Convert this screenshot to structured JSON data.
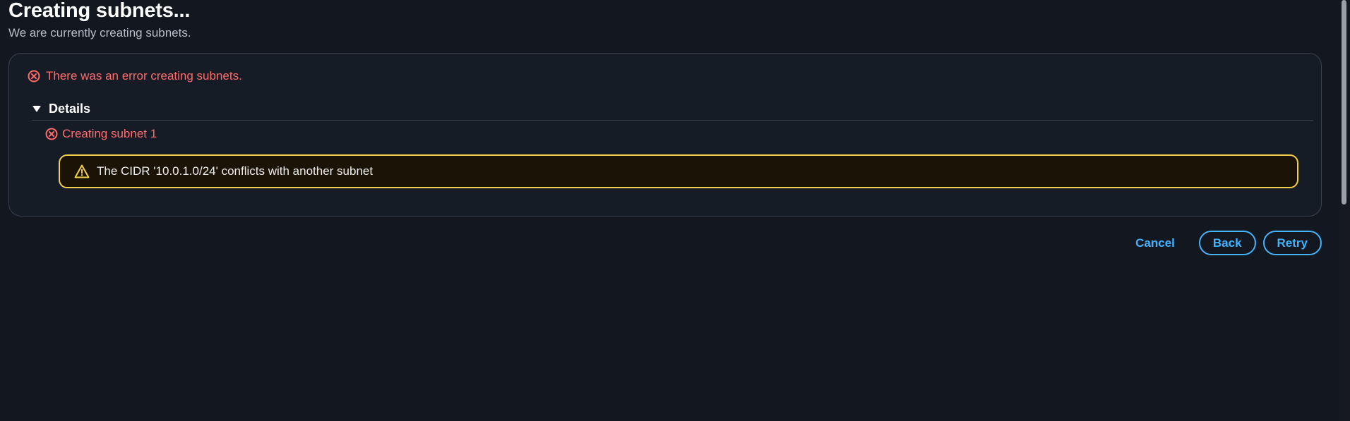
{
  "header": {
    "title": "Creating subnets...",
    "subtitle": "We are currently creating subnets."
  },
  "status": {
    "error_message": "There was an error creating subnets.",
    "error_icon": "error-circle-x-icon",
    "error_color": "#ff6b6b"
  },
  "details": {
    "label": "Details",
    "expanded": true,
    "items": [
      {
        "label": "Creating subnet 1",
        "status": "error",
        "warning": "The CIDR '10.0.1.0/24' conflicts with another subnet"
      }
    ]
  },
  "actions": {
    "cancel_label": "Cancel",
    "back_label": "Back",
    "retry_label": "Retry",
    "accent_color": "#42b4ff"
  },
  "theme": {
    "background": "#121720",
    "warning_border": "#f2d04c"
  }
}
